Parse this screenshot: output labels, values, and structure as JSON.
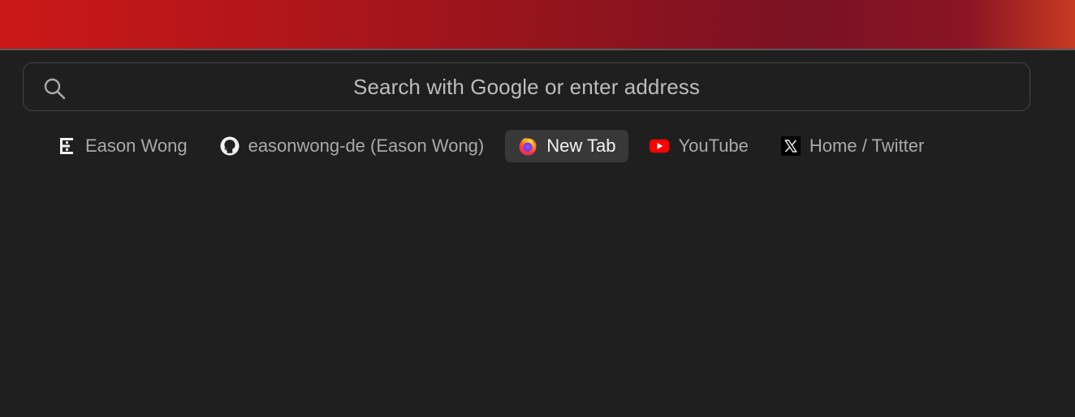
{
  "colors": {
    "background": "#1f1f1f",
    "top_gradient_start": "#cb1818",
    "top_gradient_end": "#c73a22",
    "search_border": "#444444",
    "bookmark_text": "#a9a9a9",
    "active_bg": "#383838",
    "youtube_red": "#ff0000"
  },
  "search": {
    "placeholder": "Search with Google or enter address",
    "icon": "search-icon"
  },
  "bookmarks": [
    {
      "label": "Eason Wong",
      "icon": "eason-logo-icon"
    },
    {
      "label": "easonwong-de (Eason Wong)",
      "icon": "github-icon"
    },
    {
      "label": "New Tab",
      "icon": "firefox-icon",
      "active": true
    },
    {
      "label": "YouTube",
      "icon": "youtube-icon"
    },
    {
      "label": "Home / Twitter",
      "icon": "x-icon"
    }
  ]
}
